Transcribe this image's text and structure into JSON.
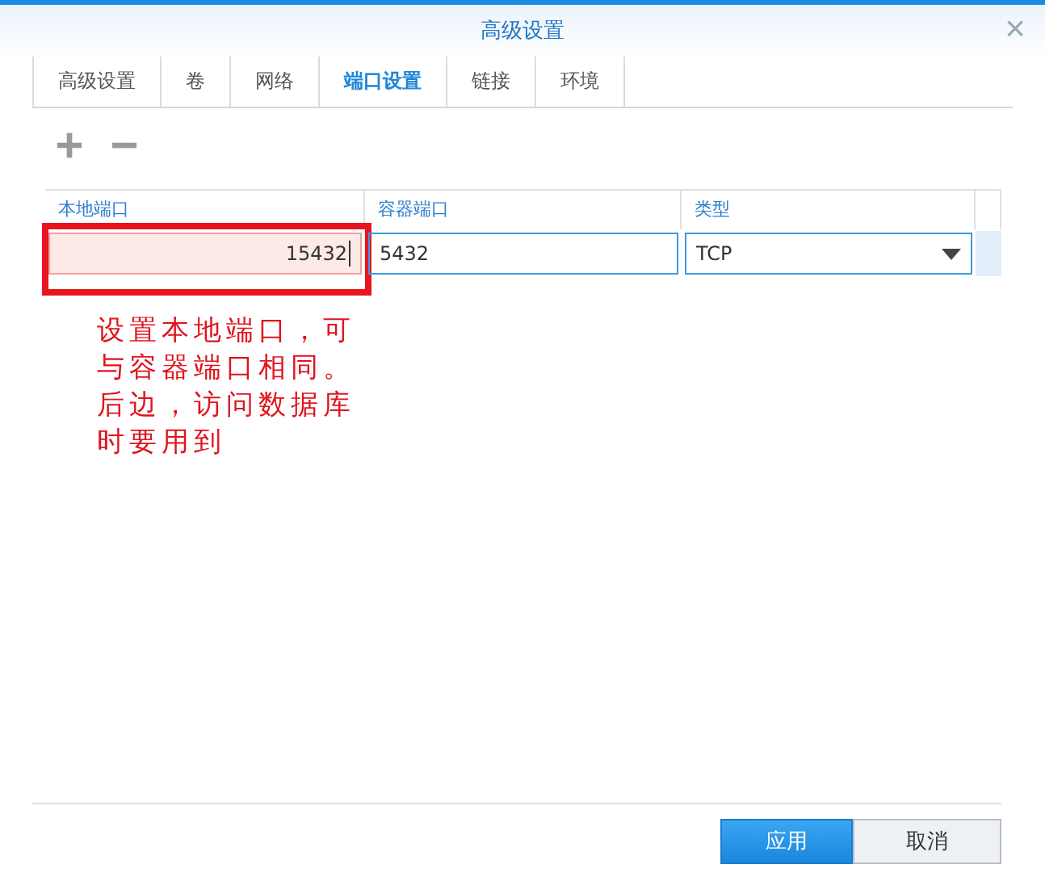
{
  "window": {
    "title": "高级设置",
    "close": "×"
  },
  "tabs": [
    {
      "label": "高级设置",
      "selected": false
    },
    {
      "label": "卷",
      "selected": false
    },
    {
      "label": "网络",
      "selected": false
    },
    {
      "label": "端口设置",
      "selected": true
    },
    {
      "label": "链接",
      "selected": false
    },
    {
      "label": "环境",
      "selected": false
    }
  ],
  "toolbar": {
    "add": "+",
    "remove": "−"
  },
  "table": {
    "columns": [
      "本地端口",
      "容器端口",
      "类型"
    ],
    "rows": [
      {
        "selected": true,
        "local_port": "15432",
        "container_port": "5432",
        "type": "TCP"
      }
    ]
  },
  "annotation": "设置本地端口，可与容器端口相同。后边，访问数据库时要用到",
  "buttons": [
    {
      "label": "应用",
      "kind": "primary"
    },
    {
      "label": "取消",
      "kind": "secondary"
    }
  ]
}
